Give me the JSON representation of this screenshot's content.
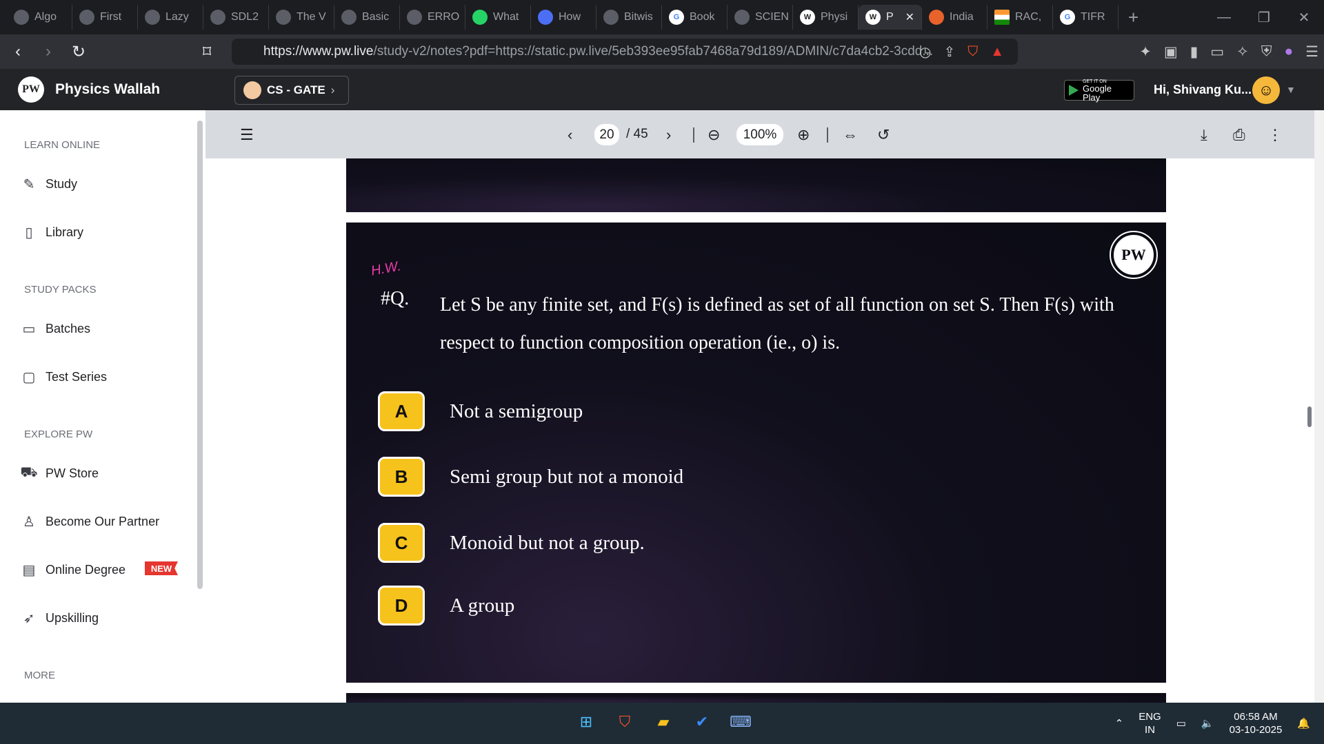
{
  "browser": {
    "tabs": [
      {
        "label": "Algo",
        "active": false
      },
      {
        "label": "First",
        "active": false
      },
      {
        "label": "Lazy",
        "active": false
      },
      {
        "label": "SDL2",
        "active": false
      },
      {
        "label": "The V",
        "active": false
      },
      {
        "label": "Basic",
        "active": false
      },
      {
        "label": "ERRO",
        "active": false
      },
      {
        "label": "What",
        "active": false
      },
      {
        "label": "How",
        "active": false
      },
      {
        "label": "Bitwis",
        "active": false
      },
      {
        "label": "Book",
        "active": false
      },
      {
        "label": "SCIEN",
        "active": false
      },
      {
        "label": "Physi",
        "active": false
      },
      {
        "label": "P",
        "active": true
      },
      {
        "label": "India",
        "active": false
      },
      {
        "label": "RAC,",
        "active": false
      },
      {
        "label": "TIFR",
        "active": false
      }
    ],
    "new_tab": "+",
    "url_host": "https://www.pw.live",
    "url_rest": "/study-v2/notes?pdf=https://static.pw.live/5eb393ee95fab7468a79d189/ADMIN/c7da4cb2-3cdd...",
    "brave_badge": "4"
  },
  "header": {
    "brand": "Physics Wallah",
    "course": "CS - GATE",
    "gplay_small": "GET IT ON",
    "gplay_big": "Google Play",
    "greeting": "Hi, Shivang Ku..."
  },
  "sidebar": {
    "sections": [
      {
        "title": "LEARN ONLINE",
        "items": [
          "Study",
          "Library"
        ]
      },
      {
        "title": "STUDY PACKS",
        "items": [
          "Batches",
          "Test Series"
        ]
      },
      {
        "title": "EXPLORE PW",
        "items": [
          "PW Store",
          "Become Our Partner",
          "Online Degree",
          "Upskilling"
        ]
      },
      {
        "title": "MORE",
        "items": []
      }
    ],
    "new_badge": "NEW"
  },
  "pdf_toolbar": {
    "current_page": "20",
    "total_pages": "/ 45",
    "zoom": "100%"
  },
  "slide": {
    "hw_mark": "H.W.",
    "q_label": "#Q.",
    "question": "Let S be any finite set, and F(s) is defined as set of all function on set S. Then F(s) with respect to function composition operation (ie., o) is.",
    "options": [
      {
        "letter": "A",
        "text": "Not a semigroup"
      },
      {
        "letter": "B",
        "text": "Semi group but not a monoid"
      },
      {
        "letter": "C",
        "text": "Monoid but not a group."
      },
      {
        "letter": "D",
        "text": "A group"
      }
    ],
    "logo_text": "PW"
  },
  "taskbar": {
    "lang1": "ENG",
    "lang2": "IN",
    "time": "06:58 AM",
    "date": "03-10-2025"
  },
  "colors": {
    "accent_yellow": "#f6c21c",
    "hw_pink": "#e83aa7",
    "new_red": "#e5362f",
    "header_bg": "#232428"
  }
}
